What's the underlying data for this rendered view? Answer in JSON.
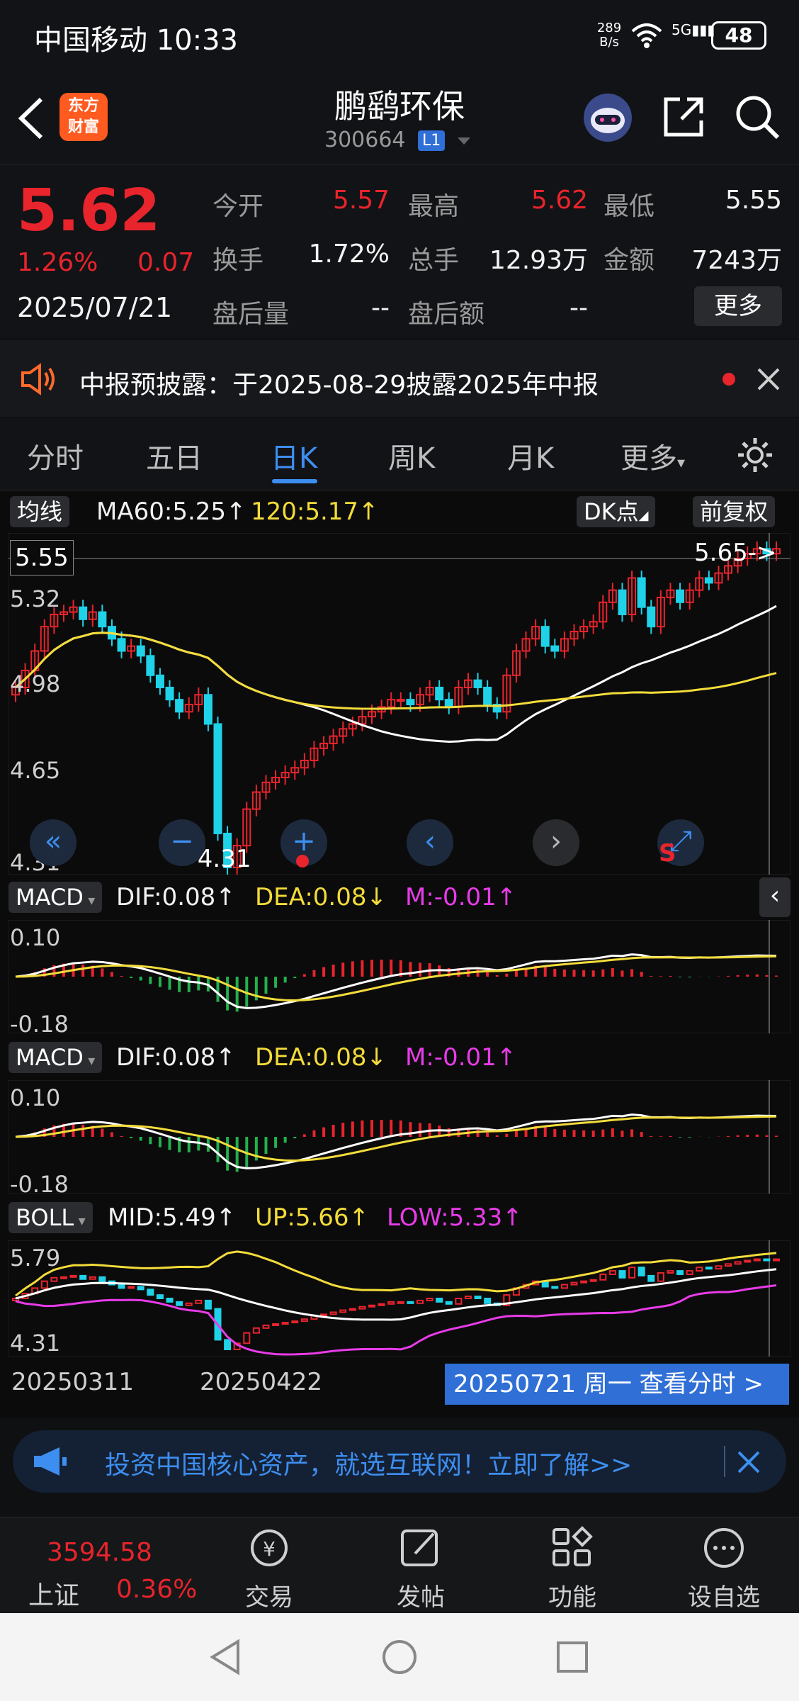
{
  "status_bar": {
    "carrier_time": "中国移动 10:33",
    "net_speed_top": "289",
    "net_speed_unit": "B/s",
    "network": "5G",
    "battery": "48"
  },
  "header": {
    "logo_text": "东方\n财富",
    "stock_name": "鹏鹞环保",
    "stock_code": "300664",
    "level": "L1"
  },
  "quote": {
    "price": "5.62",
    "change_pct": "1.26%",
    "change": "0.07",
    "date": "2025/07/21",
    "fields": [
      {
        "label": "今开",
        "value": "5.57",
        "color": "#e8242c"
      },
      {
        "label": "最高",
        "value": "5.62",
        "color": "#e8242c"
      },
      {
        "label": "最低",
        "value": "5.55",
        "color": "#f2f2f2"
      },
      {
        "label": "换手",
        "value": "1.72%",
        "color": "#f2f2f2"
      },
      {
        "label": "总手",
        "value": "12.93万",
        "color": "#f2f2f2"
      },
      {
        "label": "金额",
        "value": "7243万",
        "color": "#f2f2f2"
      },
      {
        "label": "盘后量",
        "value": "--",
        "color": "#f2f2f2"
      },
      {
        "label": "盘后额",
        "value": "--",
        "color": "#f2f2f2"
      }
    ],
    "more_label": "更多"
  },
  "notice": {
    "text": "中报预披露：于2025-08-29披露2025年中报"
  },
  "tabs": [
    "分时",
    "五日",
    "日K",
    "周K",
    "月K",
    "更多"
  ],
  "active_tab": "日K",
  "kline": {
    "ma_label": "均线",
    "ma60": "MA60:5.25↑",
    "ma120": "120:5.17↑",
    "dk_label": "DK点",
    "fq_label": "前复权",
    "crosshair_value": "5.55",
    "y_ticks": [
      "5.32",
      "4.98",
      "4.65",
      "4.31"
    ],
    "max_marker": "5.65->",
    "min_marker": "<-4.31"
  },
  "macd1": {
    "label": "MACD",
    "dif": "DIF:0.08↑",
    "dea": "DEA:0.08↓",
    "m": "M:-0.01↑",
    "y_top": "0.10",
    "y_bottom": "-0.18"
  },
  "macd2": {
    "label": "MACD",
    "dif": "DIF:0.08↑",
    "dea": "DEA:0.08↓",
    "m": "M:-0.01↑",
    "y_top": "0.10",
    "y_bottom": "-0.18"
  },
  "boll": {
    "label": "BOLL",
    "mid": "MID:5.49↑",
    "up": "UP:5.66↑",
    "low": "LOW:5.33↑",
    "y_top": "5.79",
    "y_bottom": "4.31"
  },
  "dates": {
    "d1": "20250311",
    "d2": "20250422",
    "current": "20250721 周一 查看分时 >"
  },
  "ad": {
    "text": "投资中国核心资产，就选互联网！立即了解>>"
  },
  "bottom_nav": {
    "index_value": "3594.58",
    "index_name": "上证",
    "index_pct": "0.36%",
    "items": [
      "交易",
      "发帖",
      "功能",
      "设自选"
    ]
  },
  "chart_data": {
    "type": "candlestick",
    "title": "",
    "y_range_main": [
      4.31,
      5.65
    ],
    "x_labels": [
      "20250311",
      "20250422",
      "20250721"
    ],
    "series": [
      {
        "name": "MA60",
        "last": 5.25
      },
      {
        "name": "MA120",
        "last": 5.17
      }
    ],
    "close_approx": [
      5.05,
      5.12,
      5.2,
      5.3,
      5.35,
      5.36,
      5.38,
      5.33,
      5.36,
      5.3,
      5.25,
      5.2,
      5.22,
      5.18,
      5.1,
      5.05,
      5.0,
      4.95,
      4.98,
      5.02,
      4.9,
      4.45,
      4.31,
      4.4,
      4.55,
      4.62,
      4.66,
      4.68,
      4.7,
      4.72,
      4.75,
      4.8,
      4.82,
      4.85,
      4.88,
      4.9,
      4.93,
      4.95,
      4.97,
      5.0,
      5.0,
      4.98,
      5.02,
      5.05,
      5.0,
      4.97,
      5.05,
      5.08,
      5.05,
      4.98,
      4.95,
      5.1,
      5.2,
      5.25,
      5.3,
      5.22,
      5.2,
      5.25,
      5.28,
      5.3,
      5.32,
      5.4,
      5.45,
      5.35,
      5.5,
      5.38,
      5.3,
      5.42,
      5.45,
      5.4,
      5.45,
      5.5,
      5.48,
      5.52,
      5.55,
      5.58,
      5.6,
      5.62,
      5.6,
      5.62
    ]
  }
}
